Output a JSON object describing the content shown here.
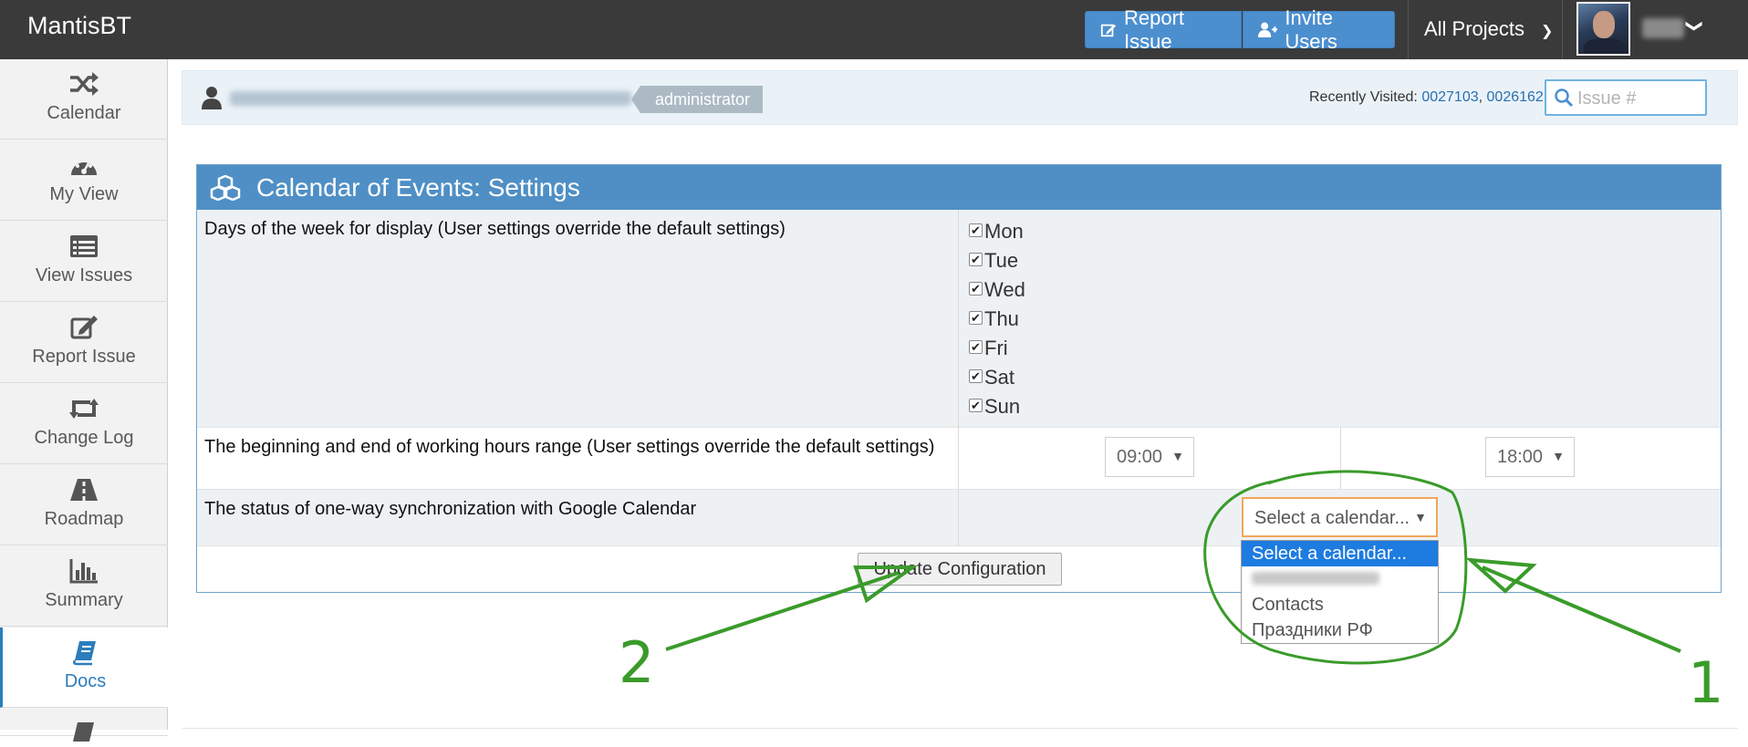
{
  "app": {
    "brand": "MantisBT"
  },
  "navbar": {
    "report_issue_label": "Report Issue",
    "invite_users_label": "Invite Users",
    "projects_label": "All Projects"
  },
  "sidebar": {
    "items": [
      {
        "label": "Calendar",
        "icon": "shuffle-icon"
      },
      {
        "label": "My View",
        "icon": "dashboard-icon"
      },
      {
        "label": "View Issues",
        "icon": "list-icon"
      },
      {
        "label": "Report Issue",
        "icon": "edit-icon"
      },
      {
        "label": "Change Log",
        "icon": "retweet-icon"
      },
      {
        "label": "Roadmap",
        "icon": "road-icon"
      },
      {
        "label": "Summary",
        "icon": "bar-chart-icon"
      },
      {
        "label": "Docs",
        "icon": "book-icon",
        "active": true
      }
    ]
  },
  "breadcrumb": {
    "role": "administrator",
    "recently_visited_label": "Recently Visited:",
    "recent_links": [
      "0027103",
      "0026162"
    ],
    "search_placeholder": "Issue #"
  },
  "panel": {
    "title": "Calendar of Events: Settings",
    "days_label": "Days of the week for display (User settings override the default settings)",
    "days": [
      {
        "label": "Mon",
        "checked": true
      },
      {
        "label": "Tue",
        "checked": true
      },
      {
        "label": "Wed",
        "checked": true
      },
      {
        "label": "Thu",
        "checked": true
      },
      {
        "label": "Fri",
        "checked": true
      },
      {
        "label": "Sat",
        "checked": true
      },
      {
        "label": "Sun",
        "checked": true
      }
    ],
    "hours_label": "The beginning and end of working hours range (User settings override the default settings)",
    "start_time": "09:00",
    "end_time": "18:00",
    "sync_label": "The status of one-way synchronization with Google Calendar",
    "calendar_select_value": "Select a calendar...",
    "update_button": "Update Configuration"
  },
  "calendar_dropdown": {
    "options": [
      "Select a calendar...",
      "",
      "Contacts",
      "Праздники РФ"
    ],
    "selected_index": 0
  },
  "annotations": {
    "label_1": "1",
    "label_2": "2",
    "color": "#3a9b2a"
  },
  "colors": {
    "navbar": "#3a3a3a",
    "accent": "#4f8fc5",
    "highlight": "#1e7be0"
  }
}
